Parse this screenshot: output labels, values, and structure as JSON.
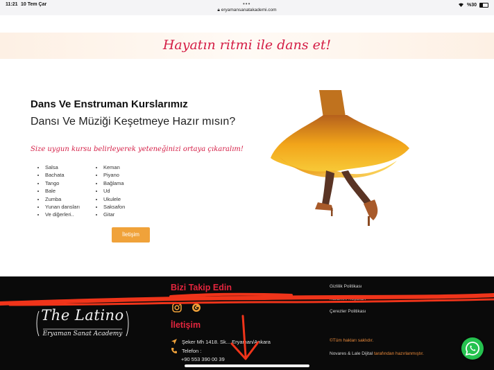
{
  "status_bar": {
    "time": "11:21",
    "date": "10 Tem Çar",
    "url": "eryamansanatakademi.com",
    "battery": "%30",
    "more_dots": "•••"
  },
  "banner": {
    "text": "Hayatın ritmi ile dans et!"
  },
  "hero": {
    "title": "Dans Ve Enstruman Kurslarımız",
    "subtitle": "Dansı Ve Müziği Keşetmeye Hazır mısın?",
    "tagline": "Size uygun kursu belirleyerek yeteneğinizi ortaya çıkaralım!",
    "dance_list": [
      "Salsa",
      "Bachata",
      "Tango",
      "Bale",
      "Zumba",
      "Yunan dansları",
      "Ve diğerleri.."
    ],
    "instrument_list": [
      "Keman",
      "Piyano",
      "Bağlama",
      "Ud",
      "Ukulele",
      "Saksafon",
      "Gitar"
    ],
    "cta_label": "İletişim"
  },
  "footer": {
    "follow_title": "Bizi Takip Edin",
    "contact_title": "İletişim",
    "address": "Şeker Mh 1418. Sk... Eryaman/Ankara",
    "phone_label": "Telefon :",
    "phone": "+90 553 390 00 39",
    "links": [
      "Gizlilik Politikası",
      "Kullanım Koşulları",
      "Çerezler Politikası"
    ],
    "copyright": "©Tüm hakları saklıdır.",
    "credit": "Novares & Lale Dijital",
    "credit_tail": "tarafından hazırlanmıştır."
  },
  "logo": {
    "script": "The Latino",
    "subtitle": "Eryaman Sanat Academy"
  },
  "colors": {
    "accent_red": "#d41d45",
    "accent_orange": "#f0a23a",
    "footer_bg": "#0a0a0a",
    "whatsapp": "#25c24f"
  },
  "icons": {
    "whatsapp": "whatsapp-icon",
    "instagram": "instagram-icon",
    "location": "location-arrow-icon",
    "phone": "phone-icon"
  }
}
